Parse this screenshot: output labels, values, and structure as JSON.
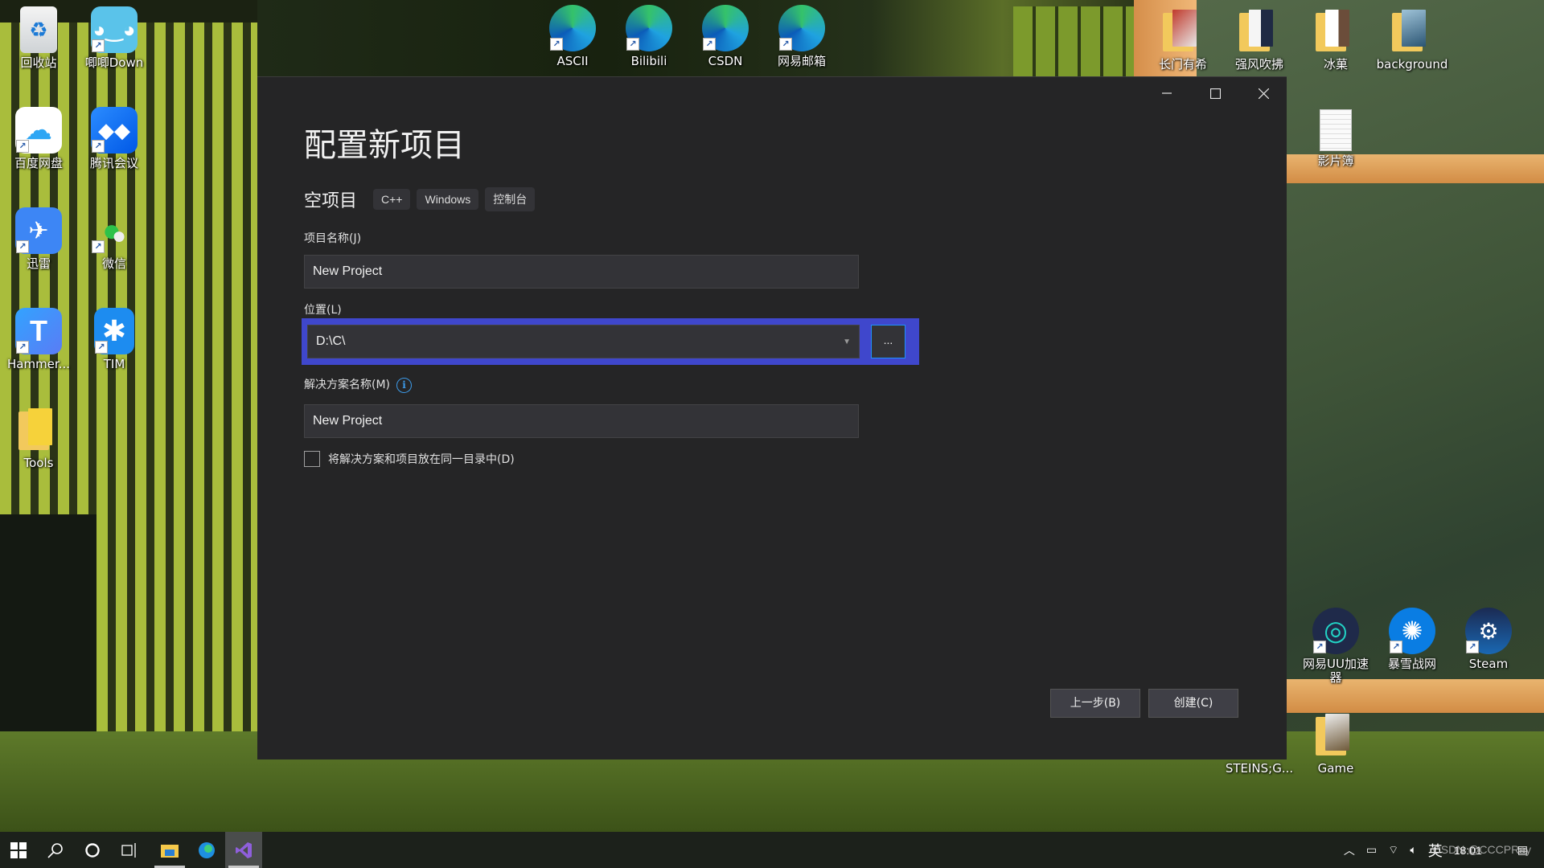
{
  "desktop": {
    "left_icons": [
      {
        "label": "回收站",
        "icon": "recycle-bin-icon"
      },
      {
        "label": "唧唧Down",
        "icon": "jijidown-icon"
      },
      {
        "label": "百度网盘",
        "icon": "baidu-netdisk-icon"
      },
      {
        "label": "腾讯会议",
        "icon": "tencent-meeting-icon"
      },
      {
        "label": "迅雷",
        "icon": "xunlei-icon"
      },
      {
        "label": "微信",
        "icon": "wechat-icon"
      },
      {
        "label": "Hammer...",
        "icon": "hammer-icon"
      },
      {
        "label": "TIM",
        "icon": "tim-icon"
      },
      {
        "label": "Tools",
        "icon": "folder-icon"
      }
    ],
    "top_icons": [
      {
        "label": "ASCII",
        "icon": "edge-icon"
      },
      {
        "label": "Bilibili",
        "icon": "edge-icon"
      },
      {
        "label": "CSDN",
        "icon": "edge-icon"
      },
      {
        "label": "网易邮箱",
        "icon": "edge-icon"
      }
    ],
    "right_icons": [
      {
        "label": "长门有希",
        "icon": "folder-icon"
      },
      {
        "label": "强风吹拂",
        "icon": "folder-icon"
      },
      {
        "label": "冰菓",
        "icon": "folder-icon"
      },
      {
        "label": "background",
        "icon": "folder-icon"
      },
      {
        "label": "影片簿",
        "icon": "document-icon"
      },
      {
        "label": "网易UU加速器",
        "icon": "uu-accelerator-icon"
      },
      {
        "label": "暴雪战网",
        "icon": "battlenet-icon"
      },
      {
        "label": "Steam",
        "icon": "steam-icon"
      },
      {
        "label": "STEINS;G...",
        "icon": "folder-icon"
      },
      {
        "label": "Game",
        "icon": "folder-icon"
      }
    ]
  },
  "dialog": {
    "title": "配置新项目",
    "template_name": "空项目",
    "tags": [
      "C++",
      "Windows",
      "控制台"
    ],
    "project_name_label": "项目名称(J)",
    "project_name_value": "New Project",
    "location_label": "位置(L)",
    "location_value": "D:\\C\\",
    "browse_label": "...",
    "solution_name_label": "解决方案名称(M)",
    "solution_name_value": "New Project",
    "same_dir_checkbox_label": "将解决方案和项目放在同一目录中(D)",
    "same_dir_checked": false,
    "back_button": "上一步(B)",
    "create_button": "创建(C)",
    "highlight_color": "#3f47cc"
  },
  "taskbar": {
    "ime": "英",
    "time": "18:01",
    "watermark": "CSDN @CCCPRay"
  }
}
